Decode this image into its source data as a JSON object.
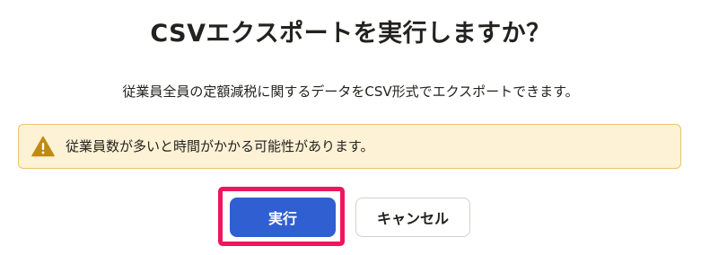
{
  "dialog": {
    "title": "CSVエクスポートを実行しますか？",
    "description": "従業員全員の定額減税に関するデータをCSV形式でエクスポートできます。",
    "warning": {
      "icon": "warning-icon",
      "text": "従業員数が多いと時間がかかる可能性があります。"
    },
    "actions": {
      "execute_label": "実行",
      "cancel_label": "キャンセル"
    }
  },
  "colors": {
    "primary_button": "#2f5fd0",
    "highlight_border": "#f0155e",
    "warning_background": "#fdf1d6",
    "warning_border": "#e8c46a",
    "warning_icon": "#c08a10"
  }
}
